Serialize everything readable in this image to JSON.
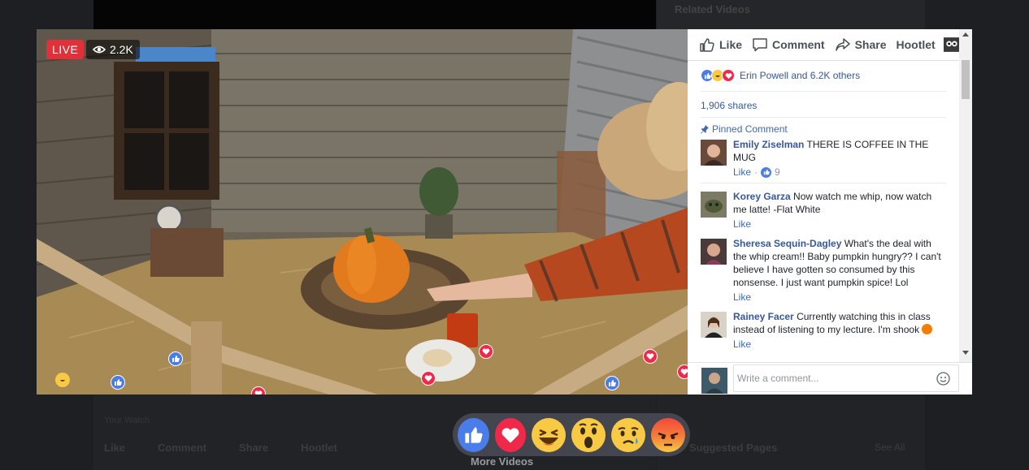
{
  "background": {
    "related_title": "Related Videos",
    "faint_line": "Your Watch",
    "actions": [
      "Like",
      "Comment",
      "Share",
      "Hootlet"
    ],
    "suggested": "Suggested Pages",
    "see_all": "See All"
  },
  "video": {
    "live_label": "LIVE",
    "viewer_count": "2.2K",
    "floating_reactions": [
      "haha",
      "like",
      "like",
      "love",
      "love",
      "love",
      "like",
      "love"
    ]
  },
  "panel": {
    "actions": {
      "like_label": "Like",
      "comment_label": "Comment",
      "share_label": "Share",
      "hootlet_label": "Hootlet"
    },
    "reactions": {
      "icons": [
        "like",
        "haha",
        "love"
      ],
      "summary": "Erin Powell and 6.2K others"
    },
    "shares": "1,906 shares",
    "pinned": {
      "label": "Pinned Comment",
      "name": "Emily Ziselman",
      "text": "THERE IS COFFEE IN THE MUG",
      "like_label": "Like",
      "like_count": "9"
    },
    "comments": [
      {
        "name": "Korey Garza",
        "text": "Now watch me whip, now watch me latte! -Flat White",
        "like_label": "Like"
      },
      {
        "name": "Sheresa Sequin-Dagley",
        "text": "What's the deal with the whip cream!! Baby pumpkin hungry?? I can't believe I have gotten so consumed by this nonsense. I just want pumpkin spice! Lol",
        "like_label": "Like"
      },
      {
        "name": "Rainey Facer",
        "text": "Currently watching this in class instead of listening to my lecture. I'm shook",
        "like_label": "Like"
      }
    ],
    "composer_placeholder": "Write a comment..."
  },
  "reaction_bar": {
    "items": [
      "like",
      "love",
      "haha",
      "wow",
      "sad",
      "angry"
    ]
  },
  "more_videos": "More Videos",
  "colors": {
    "live_red": "#e0303a",
    "fb_blue": "#4267b2",
    "link_blue": "#365899",
    "like_blue": "#4a7de9",
    "love_red": "#f0284a",
    "haha_yellow": "#f7c944"
  }
}
